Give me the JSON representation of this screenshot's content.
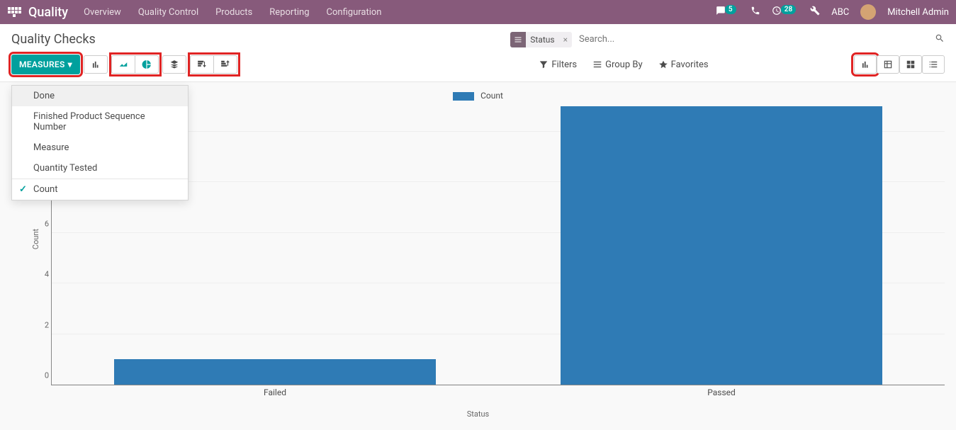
{
  "topbar": {
    "brand": "Quality",
    "menu": [
      "Overview",
      "Quality Control",
      "Products",
      "Reporting",
      "Configuration"
    ],
    "msg_badge": "5",
    "activity_badge": "28",
    "company": "ABC",
    "user": "Mitchell Admin"
  },
  "page": {
    "title": "Quality Checks"
  },
  "search": {
    "facet_label": "Status",
    "placeholder": "Search..."
  },
  "toolbar": {
    "measures_label": "MEASURES",
    "filters": "Filters",
    "groupby": "Group By",
    "favorites": "Favorites"
  },
  "measures_menu": {
    "items": [
      "Done",
      "Finished Product Sequence Number",
      "Measure",
      "Quantity Tested"
    ],
    "checked": "Count"
  },
  "chart_data": {
    "type": "bar",
    "title": "",
    "legend": "Count",
    "xlabel": "Status",
    "ylabel": "Count",
    "categories": [
      "Failed",
      "Passed"
    ],
    "values": [
      1,
      11
    ],
    "ylim": [
      0,
      11
    ],
    "yticks": [
      0,
      2,
      4,
      6,
      8,
      10
    ]
  }
}
